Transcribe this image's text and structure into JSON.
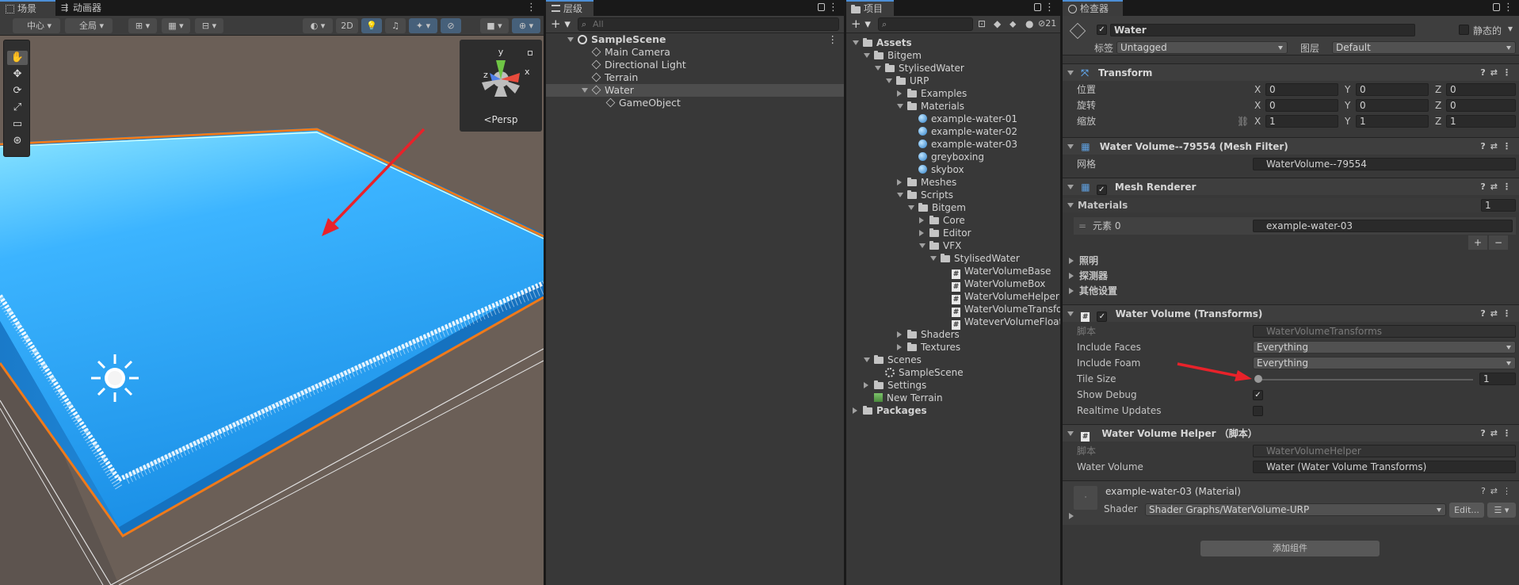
{
  "scene": {
    "tab_scene": "场景",
    "tab_animator": "动画器",
    "pivot": "中心",
    "global": "全局",
    "mode2d": "2D",
    "persp": "<Persp",
    "gizmo_y": "y",
    "gizmo_x": "x",
    "gizmo_z": "z"
  },
  "hierarchy": {
    "tab": "层级",
    "search_placeholder": "All",
    "items": [
      {
        "label": "SampleScene",
        "indent": 0,
        "icon": "unity"
      },
      {
        "label": "Main Camera",
        "indent": 1,
        "icon": "cube"
      },
      {
        "label": "Directional Light",
        "indent": 1,
        "icon": "cube"
      },
      {
        "label": "Terrain",
        "indent": 1,
        "icon": "cube"
      },
      {
        "label": "Water",
        "indent": 1,
        "icon": "cube"
      },
      {
        "label": "GameObject",
        "indent": 2,
        "icon": "cube"
      }
    ]
  },
  "project": {
    "tab": "项目",
    "count": "21",
    "items": [
      {
        "label": "Assets",
        "indent": 0,
        "icon": "folder",
        "arrow": "down",
        "bold": true
      },
      {
        "label": "Bitgem",
        "indent": 1,
        "icon": "folder",
        "arrow": "down"
      },
      {
        "label": "StylisedWater",
        "indent": 2,
        "icon": "folder",
        "arrow": "down"
      },
      {
        "label": "URP",
        "indent": 3,
        "icon": "folder",
        "arrow": "down"
      },
      {
        "label": "Examples",
        "indent": 4,
        "icon": "folder",
        "arrow": "right"
      },
      {
        "label": "Materials",
        "indent": 4,
        "icon": "folder",
        "arrow": "down"
      },
      {
        "label": "example-water-01",
        "indent": 5,
        "icon": "mat"
      },
      {
        "label": "example-water-02",
        "indent": 5,
        "icon": "mat"
      },
      {
        "label": "example-water-03",
        "indent": 5,
        "icon": "mat"
      },
      {
        "label": "greyboxing",
        "indent": 5,
        "icon": "mat"
      },
      {
        "label": "skybox",
        "indent": 5,
        "icon": "mat"
      },
      {
        "label": "Meshes",
        "indent": 4,
        "icon": "folder",
        "arrow": "right"
      },
      {
        "label": "Scripts",
        "indent": 4,
        "icon": "folder",
        "arrow": "down"
      },
      {
        "label": "Bitgem",
        "indent": 5,
        "icon": "folder",
        "arrow": "down"
      },
      {
        "label": "Core",
        "indent": 6,
        "icon": "folder",
        "arrow": "right"
      },
      {
        "label": "Editor",
        "indent": 6,
        "icon": "folder",
        "arrow": "right"
      },
      {
        "label": "VFX",
        "indent": 6,
        "icon": "folder",
        "arrow": "down"
      },
      {
        "label": "StylisedWater",
        "indent": 7,
        "icon": "folder",
        "arrow": "down"
      },
      {
        "label": "WaterVolumeBase",
        "indent": 8,
        "icon": "script"
      },
      {
        "label": "WaterVolumeBox",
        "indent": 8,
        "icon": "script"
      },
      {
        "label": "WaterVolumeHelper",
        "indent": 8,
        "icon": "script"
      },
      {
        "label": "WaterVolumeTransfor",
        "indent": 8,
        "icon": "script"
      },
      {
        "label": "WateverVolumeFloate",
        "indent": 8,
        "icon": "script"
      },
      {
        "label": "Shaders",
        "indent": 4,
        "icon": "folder",
        "arrow": "right"
      },
      {
        "label": "Textures",
        "indent": 4,
        "icon": "folder",
        "arrow": "right"
      },
      {
        "label": "Scenes",
        "indent": 1,
        "icon": "folder",
        "arrow": "down"
      },
      {
        "label": "SampleScene",
        "indent": 2,
        "icon": "scene"
      },
      {
        "label": "Settings",
        "indent": 1,
        "icon": "folder",
        "arrow": "right"
      },
      {
        "label": "New Terrain",
        "indent": 1,
        "icon": "terrain"
      },
      {
        "label": "Packages",
        "indent": 0,
        "icon": "folder",
        "arrow": "right",
        "bold": true
      }
    ]
  },
  "inspector": {
    "tab": "检查器",
    "name": "Water",
    "static": "静态的",
    "tag_label": "标签",
    "tag": "Untagged",
    "layer_label": "图层",
    "layer": "Default",
    "transform": {
      "title": "Transform",
      "pos": "位置",
      "rot": "旋转",
      "scale": "缩放",
      "px": "0",
      "py": "0",
      "pz": "0",
      "rx": "0",
      "ry": "0",
      "rz": "0",
      "sx": "1",
      "sy": "1",
      "sz": "1"
    },
    "meshfilter": {
      "title": "Water Volume--79554 (Mesh Filter)",
      "mesh_label": "网格",
      "mesh": "WaterVolume--79554"
    },
    "renderer": {
      "title": "Mesh Renderer",
      "materials": "Materials",
      "count": "1",
      "elem": "元素 0",
      "elem_val": "example-water-03",
      "lighting": "照明",
      "probes": "探测器",
      "other": "其他设置"
    },
    "wvt": {
      "title": "Water  Volume (Transforms)",
      "script_label": "脚本",
      "script": "WaterVolumeTransforms",
      "faces_label": "Include Faces",
      "faces": "Everything",
      "foam_label": "Include Foam",
      "foam": "Everything",
      "tile_label": "Tile Size",
      "tile": "1",
      "tile_value": 0,
      "debug_label": "Show Debug",
      "realtime_label": "Realtime Updates"
    },
    "wvh": {
      "title": "Water Volume Helper  （脚本）",
      "script_label": "脚本",
      "script": "WaterVolumeHelper",
      "vol_label": "Water Volume",
      "vol": "Water (Water Volume Transforms)"
    },
    "material": {
      "title": "example-water-03 (Material)",
      "shader_label": "Shader",
      "shader": "Shader Graphs/WaterVolume-URP",
      "edit": "Edit..."
    },
    "add": "添加组件",
    "xyz": [
      "X",
      "Y",
      "Z"
    ]
  }
}
